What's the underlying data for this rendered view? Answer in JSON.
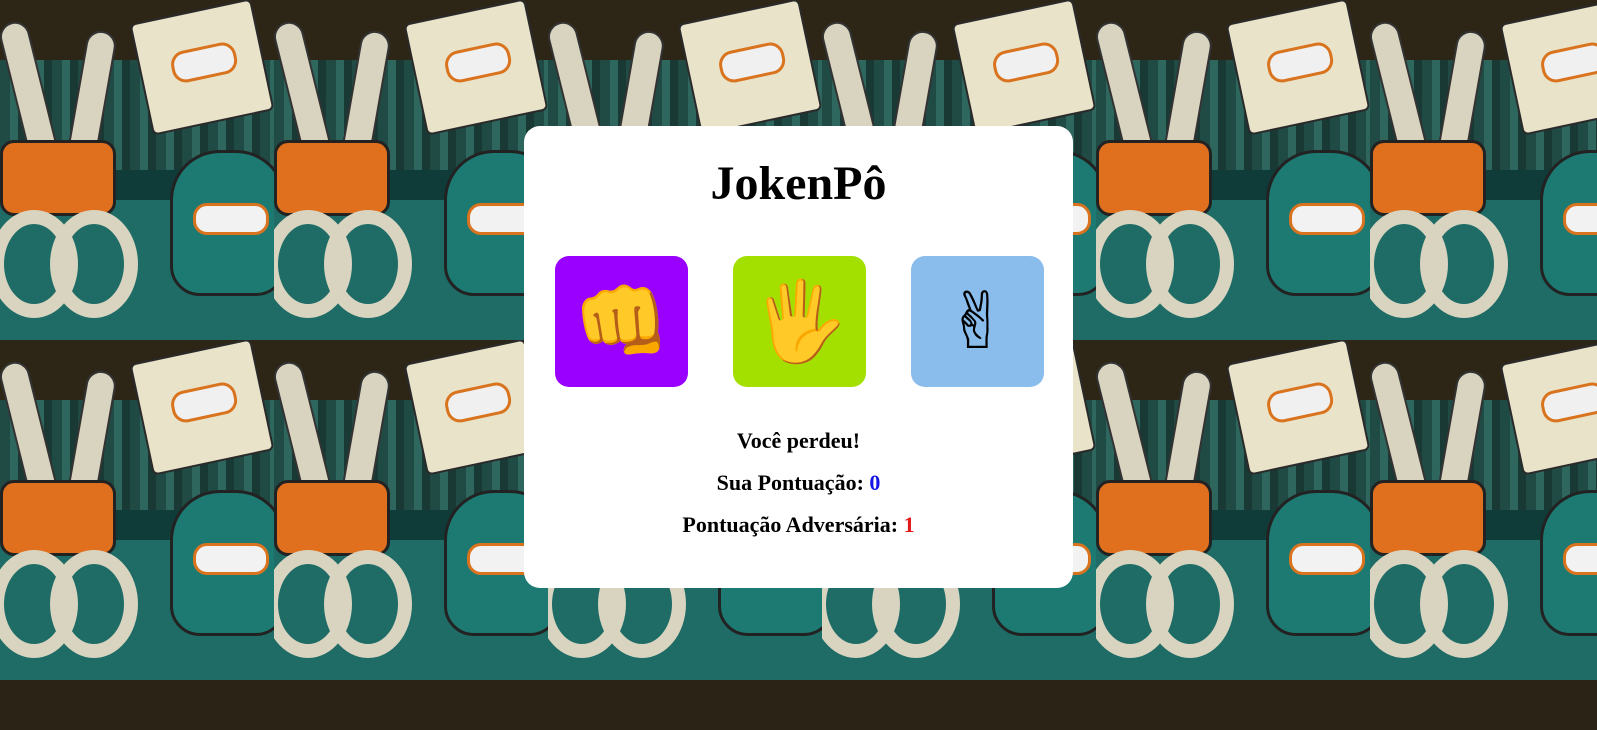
{
  "app": {
    "title": "JokenPô"
  },
  "choices": [
    {
      "name": "rock",
      "icon": "fist-icon",
      "glyph": "👊",
      "color": "#9900ff"
    },
    {
      "name": "paper",
      "icon": "raised-hand-icon",
      "glyph": "🖐",
      "color": "#a3e000"
    },
    {
      "name": "scissors",
      "icon": "victory-hand-icon",
      "glyph": "✌",
      "color": "#8abdec"
    }
  ],
  "result": {
    "message": "Você perdeu!"
  },
  "score": {
    "player_label": "Sua Pontuação:",
    "player_value": "0",
    "opponent_label": "Pontuação Adversária:",
    "opponent_value": "1"
  },
  "colors": {
    "player_score": "#1515e8",
    "opponent_score": "#e01b1b",
    "card_background": "#ffffff"
  }
}
